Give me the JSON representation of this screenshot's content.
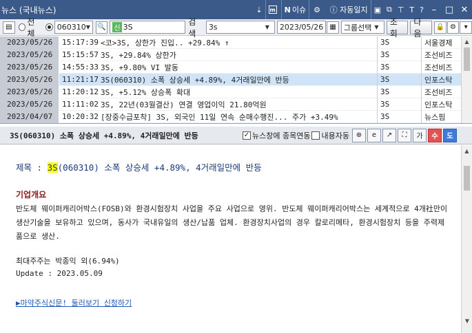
{
  "window": {
    "title": "뉴스 (국내뉴스)",
    "buttons": {
      "menu_icon": "m-icon",
      "issue": "이슈",
      "auto_diary": "자동일지"
    }
  },
  "toolbar": {
    "radio_all": "전체",
    "code_value": "060310",
    "sin_tag": "신",
    "stock_name": "3S",
    "search_label": "검색",
    "search_value": "3s",
    "date_value": "2023/05/26",
    "group_select": "그룹선택",
    "query_button": "조회",
    "next_button": "다음"
  },
  "news_list": [
    {
      "date": "2023/05/26",
      "time": "15:17:39",
      "title": "<코>3S, 상한가 진입.. +29.84% ↑",
      "code": "3S",
      "source": "서울경제"
    },
    {
      "date": "2023/05/26",
      "time": "15:15:57",
      "title": "3S, +29.84% 상한가",
      "code": "3S",
      "source": "조선비즈"
    },
    {
      "date": "2023/05/26",
      "time": "14:55:33",
      "title": "3S, +9.80% VI 발동",
      "code": "3S",
      "source": "조선비즈"
    },
    {
      "date": "2023/05/26",
      "time": "11:21:17",
      "title": "3S(060310) 소폭 상승세 +4.89%, 4거래일만에 반등",
      "code": "3S",
      "source": "인포스탁",
      "selected": true
    },
    {
      "date": "2023/05/26",
      "time": "11:20:12",
      "title": "3S, +5.12% 상승폭 확대",
      "code": "3S",
      "source": "조선비즈"
    },
    {
      "date": "2023/05/26",
      "time": "11:11:02",
      "title": "3S, 22년(03월결산) 연결 영업이익 21.80억원",
      "code": "3S",
      "source": "인포스탁"
    },
    {
      "date": "2023/04/07",
      "time": "10:20:32",
      "title": "[장중수급포착] 3S, 외국인 11일 연속 순매수행진... 주가 +3.49%",
      "code": "3S",
      "source": "뉴스핌"
    }
  ],
  "article_header": {
    "title": "3S(060310) 소폭 상승세 +4.89%, 4거래일만에 반등",
    "link_option": "뉴스창에 종목연동",
    "content_option": "내용자동",
    "font_up": "가",
    "plus": "수",
    "minus": "도"
  },
  "article": {
    "title_prefix": "제목 : ",
    "title_highlight": "3S",
    "title_rest": "(060310) 소폭 상승세 +4.89%, 4거래일만에 반등",
    "section": "기업개요",
    "paragraph": "반도체 웨이퍼캐리어박스(FOSB)와 환경시험장치 사업을 주요 사업으로 영위. 반도체 웨이퍼캐리어박스는 세계적으로 4개社만이 생산기술을 보유하고 있으며, 동사가 국내유일의 생산/납품 업체. 환경장치사업의 경우 칼로리메타, 환경시험장치 등을 주력제품으로 생산.",
    "major_holder": "최대주주는 박종익 외(6.94%)",
    "update": "Update : 2023.05.09",
    "promo_link": "▶마약주식신문! 둘러보기 신청하기"
  }
}
